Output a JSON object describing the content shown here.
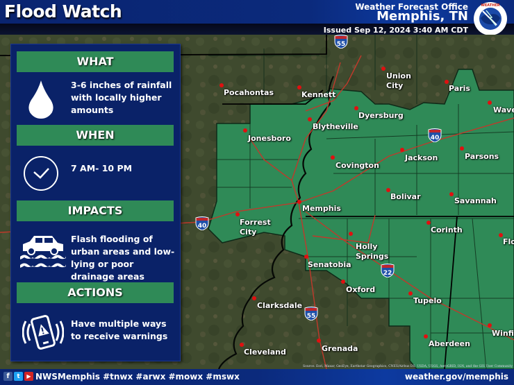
{
  "header": {
    "title": "Flood Watch",
    "office_line": "Weather Forecast Office",
    "office_city": "Memphis, TN",
    "issued": "Issued Sep 12, 2024 3:40 AM CDT",
    "logo_icon": "nws-logo-icon"
  },
  "panel": {
    "sections": [
      {
        "heading": "WHAT",
        "icon": "raindrop-icon",
        "text": "3-6 inches of rainfall with locally higher amounts"
      },
      {
        "heading": "WHEN",
        "icon": "clock-icon",
        "text": "7 AM- 10 PM"
      },
      {
        "heading": "IMPACTS",
        "icon": "flooded-car-icon",
        "text": "Flash flooding of urban areas and low-lying or poor drainage areas"
      },
      {
        "heading": "ACTIONS",
        "icon": "phone-alert-icon",
        "text": "Have multiple ways to receive warnings"
      }
    ]
  },
  "map": {
    "watch_area_color": "#2f8a57",
    "city_dot_color": "#e01010",
    "road_color": "#c0392b",
    "cities": [
      {
        "name": "Pocahontas",
        "in_watch": false
      },
      {
        "name": "Kennett",
        "in_watch": false
      },
      {
        "name": "Union City",
        "line1": "Union",
        "line2": "City",
        "in_watch": false
      },
      {
        "name": "Paris",
        "in_watch": false
      },
      {
        "name": "Waverly",
        "label": "Wave",
        "in_watch": true
      },
      {
        "name": "Jonesboro",
        "in_watch": true
      },
      {
        "name": "Blytheville",
        "in_watch": true
      },
      {
        "name": "Dyersburg",
        "in_watch": true
      },
      {
        "name": "Covington",
        "in_watch": true
      },
      {
        "name": "Jackson",
        "in_watch": true
      },
      {
        "name": "Parsons",
        "in_watch": true
      },
      {
        "name": "Memphis",
        "in_watch": true
      },
      {
        "name": "Bolivar",
        "in_watch": true
      },
      {
        "name": "Savannah",
        "in_watch": true
      },
      {
        "name": "Forrest City",
        "line1": "Forrest",
        "line2": "City",
        "in_watch": true
      },
      {
        "name": "Corinth",
        "in_watch": true
      },
      {
        "name": "Florence",
        "label": "Flo",
        "in_watch": true
      },
      {
        "name": "Holly Springs",
        "line1": "Holly",
        "line2": "Springs",
        "in_watch": true
      },
      {
        "name": "Senatobia",
        "in_watch": true
      },
      {
        "name": "Oxford",
        "in_watch": true
      },
      {
        "name": "Tupelo",
        "in_watch": true
      },
      {
        "name": "Clarksdale",
        "in_watch": false
      },
      {
        "name": "Winfield",
        "label": "Winfie",
        "in_watch": true
      },
      {
        "name": "Aberdeen",
        "in_watch": true
      },
      {
        "name": "Cleveland",
        "in_watch": false
      },
      {
        "name": "Grenada",
        "in_watch": false
      }
    ],
    "interstates": [
      "55",
      "40",
      "40",
      "22",
      "55"
    ],
    "attribution": "Source: Esri, Maxar, GeoEye, Earthstar Geographics, CNES/Airbus DS, USDA, USGS, AeroGRID, IGN, and the GIS User Community"
  },
  "footer": {
    "social_icons": [
      "facebook-icon",
      "twitter-icon",
      "youtube-icon"
    ],
    "handle": "NWSMemphis #tnwx #arwx #mowx #mswx",
    "website": "weather.gov/memphis"
  }
}
